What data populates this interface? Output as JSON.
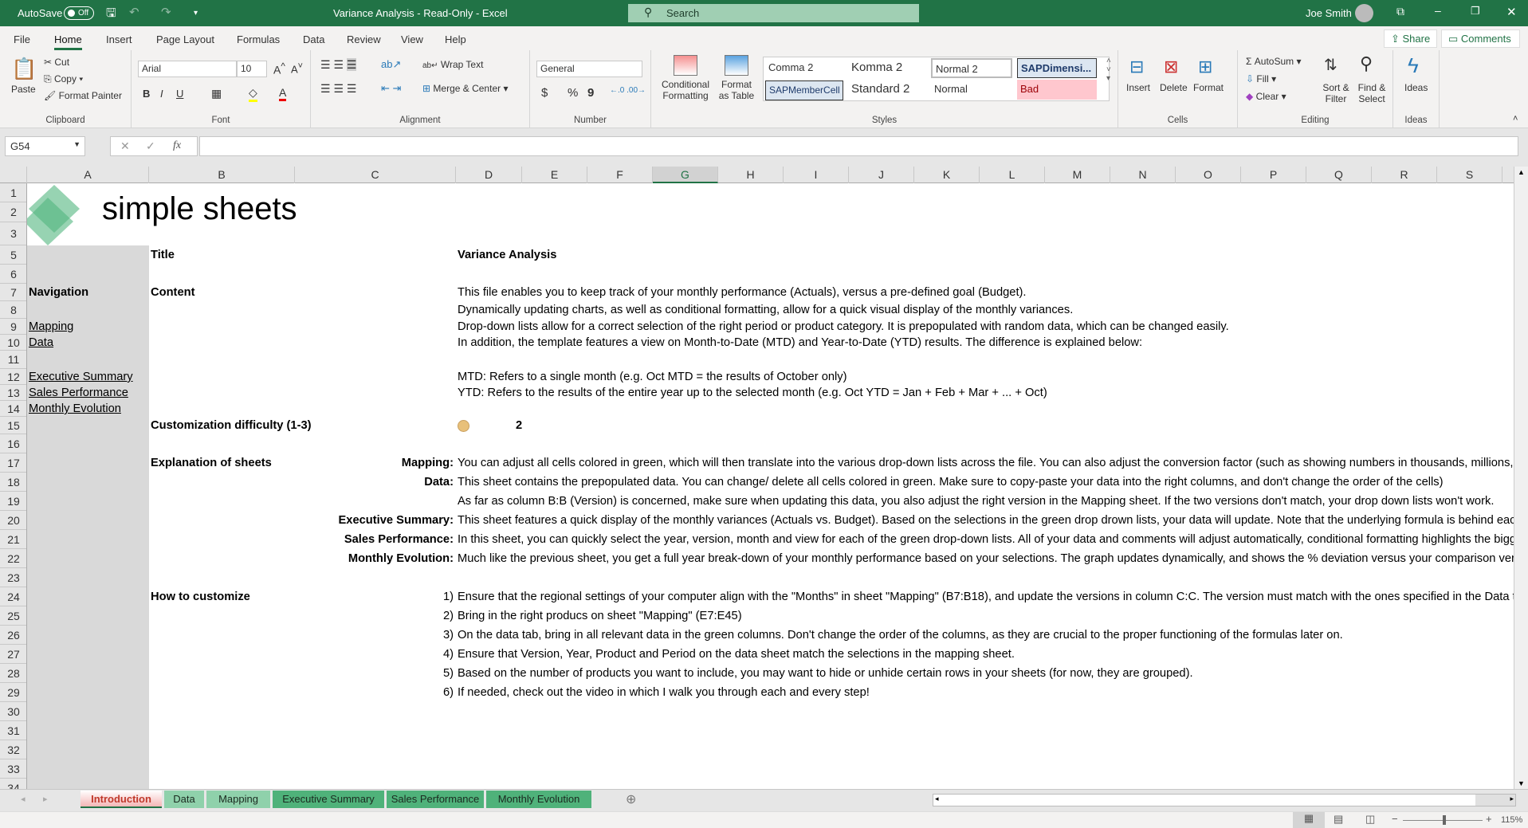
{
  "titlebar": {
    "autosave": "AutoSave",
    "autosave_state": "Off",
    "title": "Variance Analysis  -  Read-Only  -  Excel",
    "search": "Search",
    "user": "Joe Smith"
  },
  "menu": {
    "tabs": [
      "File",
      "Home",
      "Insert",
      "Page Layout",
      "Formulas",
      "Data",
      "Review",
      "View",
      "Help"
    ],
    "share": "Share",
    "comments": "Comments"
  },
  "ribbon": {
    "clipboard": {
      "paste": "Paste",
      "cut": "Cut",
      "copy": "Copy",
      "format_painter": "Format Painter",
      "label": "Clipboard"
    },
    "font": {
      "name": "Arial",
      "size": "10",
      "bold": "B",
      "italic": "I",
      "underline": "U",
      "label": "Font"
    },
    "alignment": {
      "wrap": "Wrap Text",
      "merge": "Merge & Center",
      "label": "Alignment"
    },
    "number": {
      "format": "General",
      "currency": "$",
      "percent": "%",
      "comma": "9",
      "label": "Number"
    },
    "styles": {
      "conditional": "Conditional Formatting",
      "format_table": "Format as Table",
      "cells": [
        "Comma 2",
        "Komma 2",
        "Normal 2",
        "SAPDimensi...",
        "SAPMemberCell",
        "Standard 2",
        "Normal",
        "Bad"
      ],
      "label": "Styles"
    },
    "cells": {
      "insert": "Insert",
      "delete": "Delete",
      "format": "Format",
      "label": "Cells"
    },
    "editing": {
      "autosum": "AutoSum",
      "fill": "Fill",
      "clear": "Clear",
      "sort": "Sort & Filter",
      "find": "Find & Select",
      "label": "Editing"
    },
    "ideas": {
      "ideas": "Ideas",
      "label": "Ideas"
    }
  },
  "formula_bar": {
    "name_box": "G54",
    "fx": "fx",
    "value": ""
  },
  "columns": [
    "A",
    "B",
    "C",
    "D",
    "E",
    "F",
    "G",
    "H",
    "I",
    "J",
    "K",
    "L",
    "M",
    "N",
    "O",
    "P",
    "Q",
    "R",
    "S"
  ],
  "selected_column": "G",
  "rows": [
    "1",
    "2",
    "3",
    "5",
    "6",
    "7",
    "8",
    "9",
    "10",
    "11",
    "12",
    "13",
    "14",
    "15",
    "16",
    "17",
    "18",
    "19",
    "20",
    "21",
    "22",
    "23",
    "24",
    "25",
    "26",
    "27",
    "28",
    "29",
    "30",
    "31",
    "32",
    "33",
    "34"
  ],
  "logo": {
    "text": "simple sheets"
  },
  "sheet": {
    "title_label": "Title",
    "title_value": "Variance Analysis",
    "navigation_label": "Navigation",
    "nav_links": [
      "Mapping",
      "Data",
      "Executive Summary",
      "Sales Performance",
      "Monthly Evolution"
    ],
    "content_label": "Content",
    "content_lines": [
      "This file enables you to keep track of your monthly performance (Actuals), versus a pre-defined goal (Budget).",
      "Dynamically updating charts, as well as conditional formatting, allow for a quick visual display of the monthly variances.",
      "Drop-down lists allow for a correct selection of the right period or product category. It is prepopulated with random data, which can be changed easily.",
      "In addition, the template features a view on Month-to-Date (MTD) and Year-to-Date (YTD) results. The difference is explained below:",
      "MTD: Refers to a single month (e.g. Oct MTD = the results of October only)",
      "YTD: Refers to the results of the entire year up to the selected month (e.g. Oct YTD = Jan + Feb + Mar + ... + Oct)"
    ],
    "difficulty_label": "Customization difficulty (1-3)",
    "difficulty_value": "2",
    "difficulty_color": "#e8c07a",
    "explanation_label": "Explanation of sheets",
    "explanations": [
      {
        "key": "Mapping:",
        "text": "You can adjust all cells colored in green, which will then translate into the various drop-down lists across the file. You can also adjust the conversion factor (such as showing numbers in thousands, millions,"
      },
      {
        "key": "Data:",
        "text": "This sheet contains the prepopulated data. You can change/ delete all cells colored in green. Make sure to copy-paste your data into the right columns, and don't change the order of the cells)"
      },
      {
        "key": "",
        "text": "As far as column B:B (Version) is concerned, make sure when updating this data, you also adjust the right version in the Mapping sheet. If the two versions don't match, your drop down lists won't work."
      },
      {
        "key": "Executive Summary:",
        "text": "This sheet features a quick display of the monthly variances (Actuals vs. Budget). Based on the selections in the green drop drown lists, your data will update. Note that the underlying formula is behind each"
      },
      {
        "key": "Sales Performance:",
        "text": "In this sheet, you can quickly select the year, version, month and view for each of the green drop-down lists. All of your data and comments will adjust automatically, conditional formatting highlights the bigge"
      },
      {
        "key": "Monthly Evolution:",
        "text": "Much like the previous sheet, you get a full year break-down of your monthly performance based on your selections. The graph updates dynamically, and shows the % deviation versus your comparison vers"
      }
    ],
    "customize_label": "How to customize",
    "steps": [
      {
        "n": "1)",
        "text": "Ensure that the regional settings of your computer align with the \"Months\" in sheet \"Mapping\" (B7:B18), and update the versions in column C:C. The version must match with the ones specified in the Data ta"
      },
      {
        "n": "2)",
        "text": "Bring in the right producs on sheet \"Mapping\" (E7:E45)"
      },
      {
        "n": "3)",
        "text": "On the data tab, bring in all relevant data in the green columns. Don't change the order of the columns, as they are crucial to the proper functioning of the formulas later on."
      },
      {
        "n": "4)",
        "text": "Ensure that Version, Year, Product and Period on the data sheet match the selections in the mapping sheet."
      },
      {
        "n": "5)",
        "text": "Based on the number of products you want to include, you may want to hide or unhide certain rows in your sheets (for now, they are grouped)."
      },
      {
        "n": "6)",
        "text": "If needed, check out the video in which I walk you through each and every step!"
      }
    ]
  },
  "sheet_tabs": [
    {
      "label": "Introduction",
      "color": "#f4b6b6"
    },
    {
      "label": "Data",
      "color": "#8fd1ab"
    },
    {
      "label": "Mapping",
      "color": "#8fd1ab"
    },
    {
      "label": "Executive Summary",
      "color": "#4fb27a"
    },
    {
      "label": "Sales Performance",
      "color": "#4fb27a"
    },
    {
      "label": "Monthly Evolution",
      "color": "#4fb27a"
    }
  ],
  "status": {
    "zoom": "115%"
  }
}
